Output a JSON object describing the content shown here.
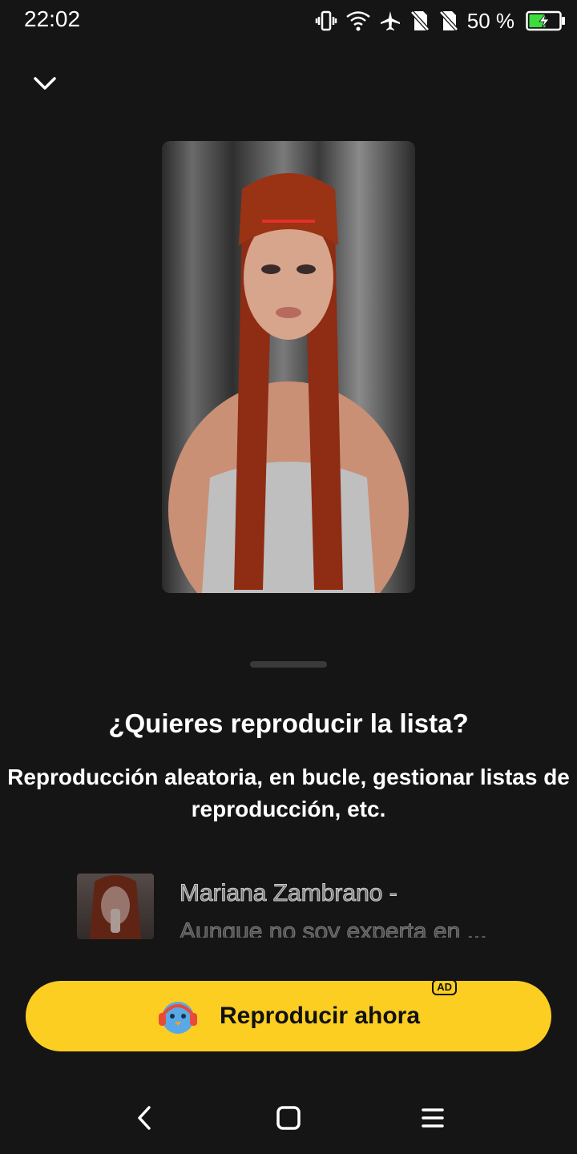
{
  "status_bar": {
    "time": "22:02",
    "battery_percent": "50 %",
    "icons": [
      "vibrate-icon",
      "wifi-icon",
      "airplane-icon",
      "no-sim-icon",
      "no-sim-icon",
      "battery-charging-icon"
    ]
  },
  "header": {
    "collapse_icon": "chevron-down-icon"
  },
  "prompt": {
    "title": "¿Quieres reproducir la lista?",
    "description": "Reproducción aleatoria, en bucle, gestionar listas de reproducción, etc."
  },
  "track": {
    "title": "Mariana Zambrano -",
    "subtitle": "Aunque no soy experta en ..."
  },
  "play_button": {
    "label": "Reproducir ahora",
    "badge": "AD",
    "icon": "bird-headphones-icon",
    "color": "#fcce22"
  },
  "nav_bar": {
    "icons": [
      "back-icon",
      "home-icon",
      "menu-icon"
    ]
  },
  "colors": {
    "background": "#151515",
    "accent": "#fcce22"
  }
}
